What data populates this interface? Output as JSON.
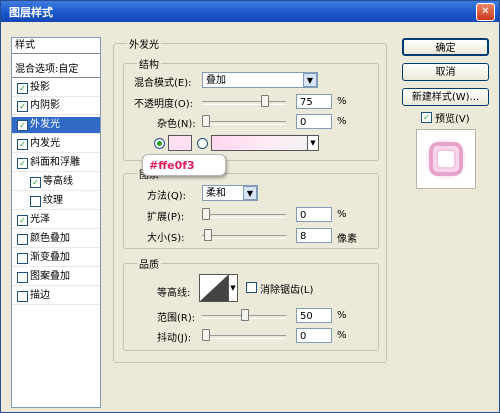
{
  "window": {
    "title": "图层样式"
  },
  "left_panel": {
    "header": "样式",
    "blend_options": "混合选项:自定",
    "items": [
      {
        "label": "投影",
        "checked": true
      },
      {
        "label": "内阴影",
        "checked": true
      },
      {
        "label": "外发光",
        "checked": true,
        "selected": true
      },
      {
        "label": "内发光",
        "checked": true
      },
      {
        "label": "斜面和浮雕",
        "checked": true
      },
      {
        "label": "等高线",
        "checked": true,
        "sub": true
      },
      {
        "label": "纹理",
        "checked": false,
        "sub": true
      },
      {
        "label": "光泽",
        "checked": true
      },
      {
        "label": "颜色叠加",
        "checked": false
      },
      {
        "label": "渐变叠加",
        "checked": false
      },
      {
        "label": "图案叠加",
        "checked": false
      },
      {
        "label": "描边",
        "checked": false
      }
    ]
  },
  "outer_glow": {
    "section_title": "外发光",
    "structure": {
      "title": "结构",
      "blend_mode_label": "混合模式(E):",
      "blend_mode_value": "叠加",
      "opacity_label": "不透明度(O):",
      "opacity_value": "75",
      "opacity_unit": "%",
      "noise_label": "杂色(N):",
      "noise_value": "0",
      "noise_unit": "%",
      "glow_color": "#ffe0f3"
    },
    "elements": {
      "title": "图素",
      "technique_label": "方法(Q):",
      "technique_value": "柔和",
      "spread_label": "扩展(P):",
      "spread_value": "0",
      "spread_unit": "%",
      "size_label": "大小(S):",
      "size_value": "8",
      "size_unit": "像素"
    },
    "quality": {
      "title": "品质",
      "contour_label": "等高线:",
      "antialias_label": "消除锯齿(L)",
      "range_label": "范围(R):",
      "range_value": "50",
      "range_unit": "%",
      "jitter_label": "抖动(J):",
      "jitter_value": "0",
      "jitter_unit": "%"
    }
  },
  "tooltip": {
    "text": "#ffe0f3"
  },
  "buttons": {
    "ok": "确定",
    "cancel": "取消",
    "new_style": "新建样式(W)...",
    "preview": "预览(V)"
  },
  "colors": {
    "accent": "#316ac5",
    "glow": "#ffe0f3",
    "tooltip_text": "#e0205c"
  },
  "slider_levels": {
    "opacity": 0.75,
    "noise": 0,
    "spread": 0,
    "size": 0.03,
    "range": 0.5,
    "jitter": 0
  }
}
